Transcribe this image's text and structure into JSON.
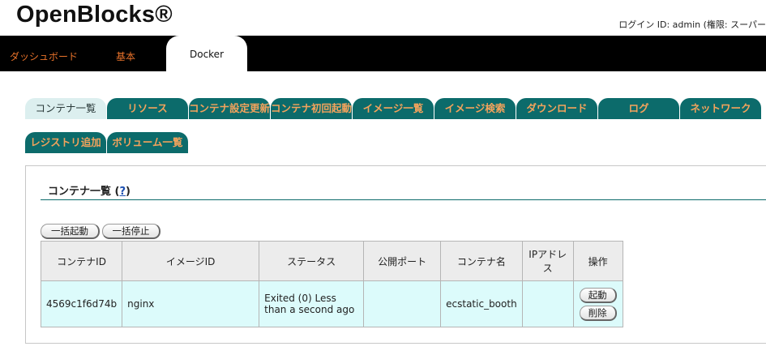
{
  "header": {
    "logo": "OpenBlocks®",
    "login_info": "ログイン ID: admin (権限: スーパー"
  },
  "topnav": {
    "items": [
      "ダッシュボード",
      "基本"
    ],
    "active": "Docker"
  },
  "subtabs": [
    "コンテナ一覧",
    "リソース",
    "コンテナ設定更新",
    "コンテナ初回起動",
    "イメージ一覧",
    "イメージ検索",
    "ダウンロード",
    "ログ",
    "ネットワーク",
    "レジストリ追加",
    "ボリューム一覧"
  ],
  "panel": {
    "title": "コンテナ一覧",
    "help_open": "(",
    "help": "?",
    "help_close": ")",
    "bulk_start": "一括起動",
    "bulk_stop": "一括停止"
  },
  "table": {
    "headers": [
      "コンテナID",
      "イメージID",
      "ステータス",
      "公開ポート",
      "コンテナ名",
      "IPアドレス",
      "操作"
    ],
    "rows": [
      {
        "container_id": "4569c1f6d74b",
        "image_id": "nginx",
        "status": "Exited (0) Less than a second ago",
        "port": "",
        "name": "ecstatic_booth",
        "ip": "",
        "start": "起動",
        "delete": "削除"
      }
    ]
  },
  "colors": {
    "tab_bg": "#0c6b6b",
    "tab_text": "#f3a35c",
    "nav_text": "#e8722a",
    "row_bg": "#dcfbfb"
  }
}
